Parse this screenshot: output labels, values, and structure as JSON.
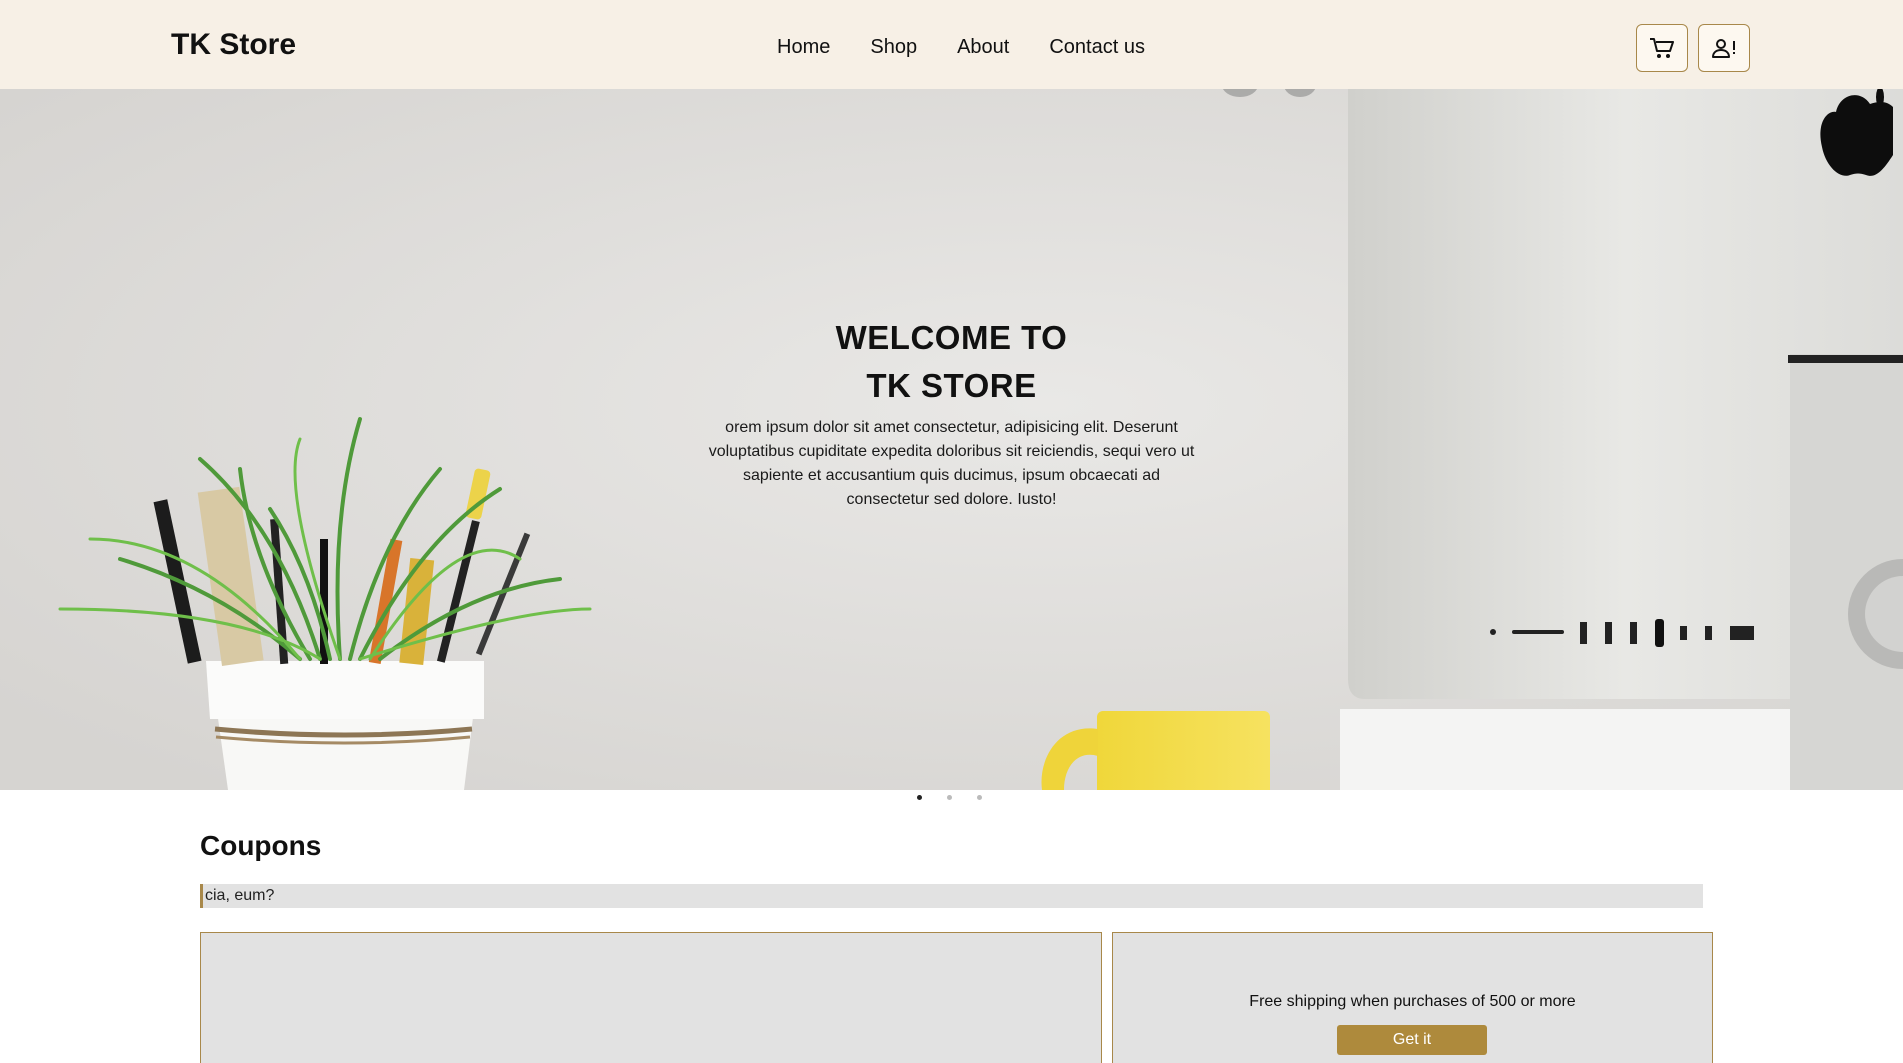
{
  "navbar": {
    "brand": "TK Store",
    "links": [
      "Home",
      "Shop",
      "About",
      "Contact us"
    ],
    "icons": [
      "cart-icon",
      "user-alert-icon"
    ],
    "background_color": "#f7f0e6",
    "accent_color": "#a8884a"
  },
  "hero": {
    "title": "WELCOME TO\nTK STORE",
    "body": "orem ipsum dolor sit amet consectetur, adipisicing elit. Deserunt voluptatibus cupiditate expedita doloribus sit reiciendis, sequi vero ut sapiente et accusantium quis ducimus, ipsum obcaecati ad consectetur sed dolore. Iusto!",
    "carousel": {
      "slides": 3,
      "active": 1
    }
  },
  "coupons": {
    "title": "Coupons",
    "ticker_text": "cia, eum?",
    "cards": [
      {
        "text": "",
        "button": ""
      },
      {
        "text": "Free shipping when purchases of 500 or more",
        "button": "Get it"
      }
    ],
    "button_color": "#ae8a3c"
  }
}
